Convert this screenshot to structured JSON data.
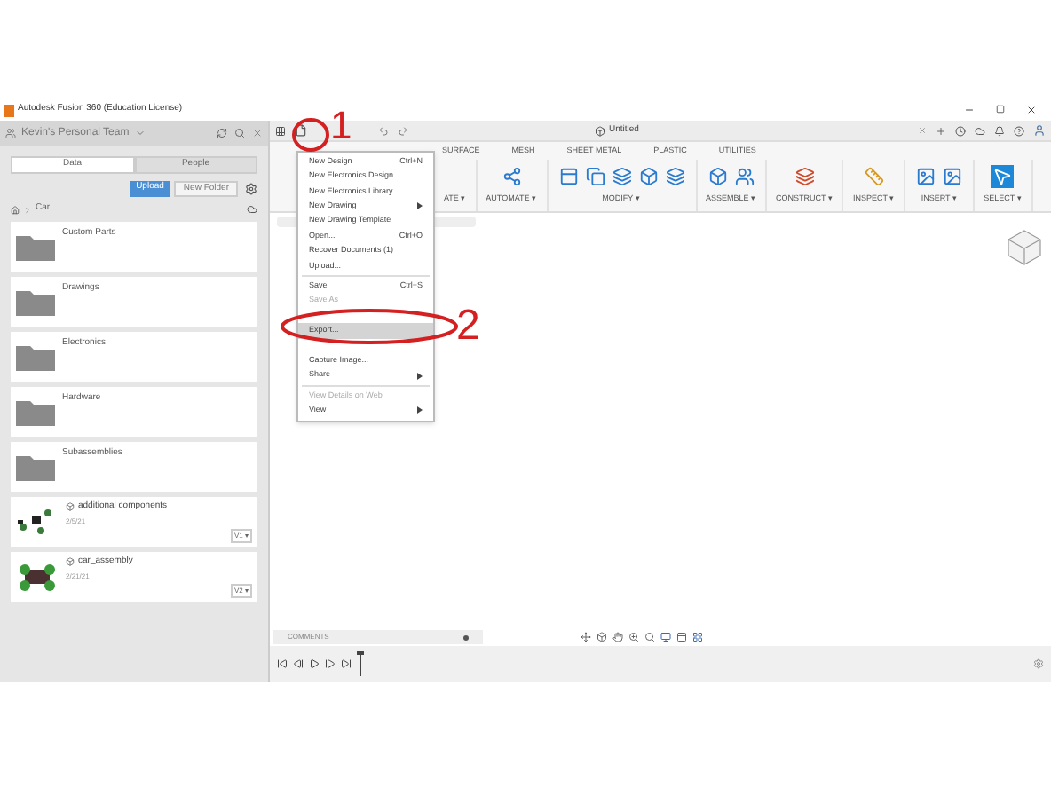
{
  "title_bar": {
    "title": "Autodesk Fusion 360 (Education License)"
  },
  "data_panel": {
    "team": "Kevin's Personal Team",
    "tabs": [
      {
        "label": "Data",
        "selected": true
      },
      {
        "label": "People",
        "selected": false
      }
    ],
    "buttons": [
      {
        "label": "Upload",
        "kind": "primary"
      },
      {
        "label": "New Folder",
        "kind": "secondary"
      }
    ],
    "breadcrumb": "Car",
    "items": [
      {
        "kind": "folder",
        "name": "Custom Parts"
      },
      {
        "kind": "folder",
        "name": "Drawings"
      },
      {
        "kind": "folder",
        "name": "Electronics"
      },
      {
        "kind": "folder",
        "name": "Hardware"
      },
      {
        "kind": "folder",
        "name": "Subassemblies"
      },
      {
        "kind": "design",
        "name": "additional components",
        "date": "2/5/21",
        "version": "V1 ▾"
      },
      {
        "kind": "design",
        "name": "car_assembly",
        "date": "2/21/21",
        "version": "V2 ▾"
      }
    ]
  },
  "document_tab": {
    "title": "Untitled"
  },
  "toolbar": {
    "tabs": [
      "SURFACE",
      "MESH",
      "SHEET METAL",
      "PLASTIC",
      "UTILITIES"
    ],
    "groups": [
      "ATE ▾",
      "AUTOMATE ▾",
      "MODIFY ▾",
      "ASSEMBLE ▾",
      "CONSTRUCT ▾",
      "INSPECT ▾",
      "INSERT ▾",
      "SELECT ▾"
    ]
  },
  "file_menu": [
    {
      "kind": "item",
      "label": "New Design",
      "shortcut": "Ctrl+N",
      "submenu": false,
      "disabled": false,
      "selected": false
    },
    {
      "kind": "item",
      "label": "New Electronics Design",
      "submenu": false,
      "disabled": false,
      "selected": false
    },
    {
      "kind": "item",
      "label": "New Electronics Library",
      "submenu": false,
      "disabled": false,
      "selected": false
    },
    {
      "kind": "item",
      "label": "New Drawing",
      "submenu": true,
      "disabled": false,
      "selected": false
    },
    {
      "kind": "item",
      "label": "New Drawing Template",
      "submenu": false,
      "disabled": false,
      "selected": false
    },
    {
      "kind": "item",
      "label": "Open...",
      "shortcut": "Ctrl+O",
      "submenu": false,
      "disabled": false,
      "selected": false
    },
    {
      "kind": "item",
      "label": "Recover Documents (1)",
      "submenu": false,
      "disabled": false,
      "selected": false
    },
    {
      "kind": "item",
      "label": "Upload...",
      "submenu": false,
      "disabled": false,
      "selected": false
    },
    {
      "kind": "divider"
    },
    {
      "kind": "item",
      "label": "Save",
      "shortcut": "Ctrl+S",
      "submenu": false,
      "disabled": false,
      "selected": false
    },
    {
      "kind": "item",
      "label": "Save As",
      "submenu": false,
      "disabled": true,
      "selected": false
    },
    {
      "kind": "covered"
    },
    {
      "kind": "item",
      "label": "Export...",
      "submenu": false,
      "disabled": false,
      "selected": true
    },
    {
      "kind": "covered"
    },
    {
      "kind": "item",
      "label": "Capture Image...",
      "submenu": false,
      "disabled": false,
      "selected": false
    },
    {
      "kind": "item",
      "label": "Share",
      "submenu": true,
      "disabled": false,
      "selected": false
    },
    {
      "kind": "divider"
    },
    {
      "kind": "item",
      "label": "View Details on Web",
      "submenu": false,
      "disabled": true,
      "selected": false
    },
    {
      "kind": "item",
      "label": "View",
      "submenu": true,
      "disabled": false,
      "selected": false
    }
  ],
  "comments": {
    "label": "COMMENTS"
  },
  "annotations": [
    {
      "label": "1"
    },
    {
      "label": "2"
    }
  ]
}
